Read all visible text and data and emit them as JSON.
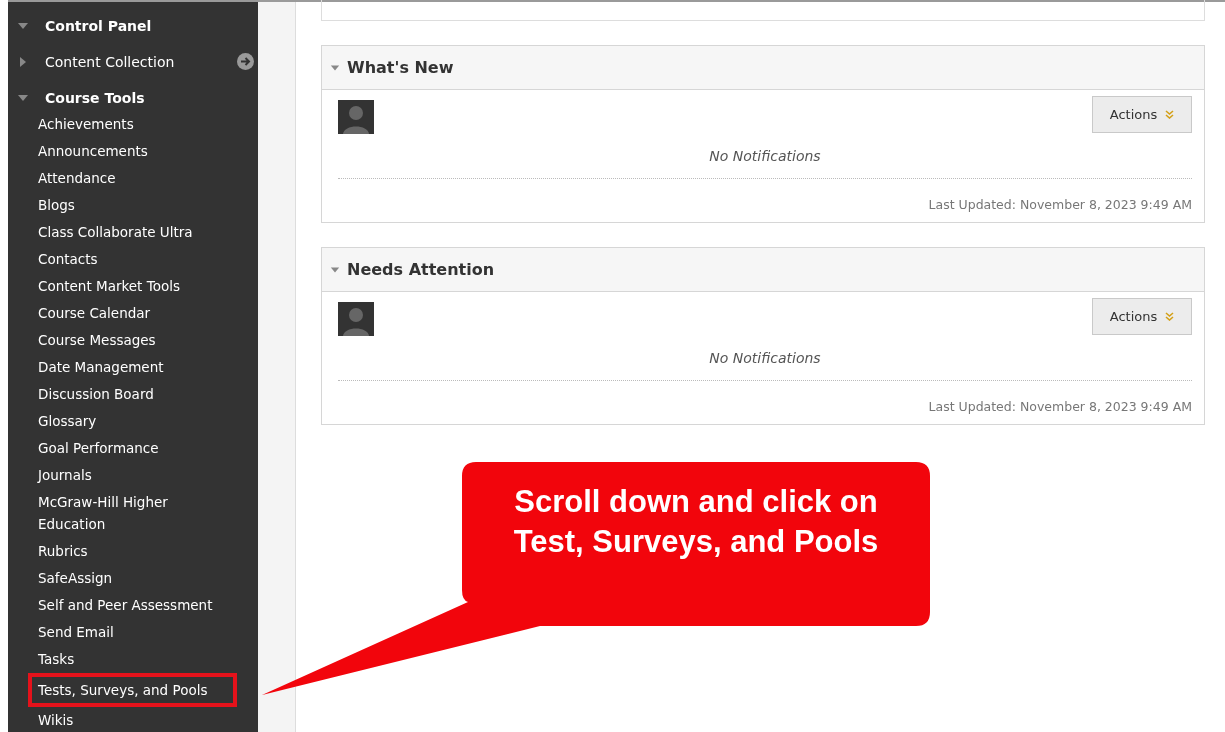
{
  "sidebar": {
    "title": "Control Panel",
    "expanded": true,
    "sections": [
      {
        "label": "Content Collection",
        "expanded": false,
        "has_link_arrow": true
      },
      {
        "label": "Course Tools",
        "expanded": true,
        "items": [
          {
            "label": "Achievements",
            "highlighted": false
          },
          {
            "label": "Announcements",
            "highlighted": false
          },
          {
            "label": "Attendance",
            "highlighted": false
          },
          {
            "label": "Blogs",
            "highlighted": false
          },
          {
            "label": "Class Collaborate Ultra",
            "highlighted": false
          },
          {
            "label": "Contacts",
            "highlighted": false
          },
          {
            "label": "Content Market Tools",
            "highlighted": false
          },
          {
            "label": "Course Calendar",
            "highlighted": false
          },
          {
            "label": "Course Messages",
            "highlighted": false
          },
          {
            "label": "Date Management",
            "highlighted": false
          },
          {
            "label": "Discussion Board",
            "highlighted": false
          },
          {
            "label": "Glossary",
            "highlighted": false
          },
          {
            "label": "Goal Performance",
            "highlighted": false
          },
          {
            "label": "Journals",
            "highlighted": false
          },
          {
            "label": "McGraw-Hill Higher Education",
            "highlighted": false
          },
          {
            "label": "Rubrics",
            "highlighted": false
          },
          {
            "label": "SafeAssign",
            "highlighted": false
          },
          {
            "label": "Self and Peer Assessment",
            "highlighted": false
          },
          {
            "label": "Send Email",
            "highlighted": false
          },
          {
            "label": "Tasks",
            "highlighted": false
          },
          {
            "label": "Tests, Surveys, and Pools",
            "highlighted": true
          },
          {
            "label": "Wikis",
            "highlighted": false
          }
        ]
      }
    ]
  },
  "modules": [
    {
      "title": "What's New",
      "expanded": true,
      "actions": "Actions",
      "message": "No Notifications",
      "updated": "Last Updated: November 8, 2023 9:49 AM"
    },
    {
      "title": "Needs Attention",
      "expanded": true,
      "actions": "Actions",
      "message": "No Notifications",
      "updated": "Last Updated: November 8, 2023 9:49 AM"
    }
  ],
  "callout": {
    "text": "Scroll down and click on Test, Surveys, and Pools"
  }
}
